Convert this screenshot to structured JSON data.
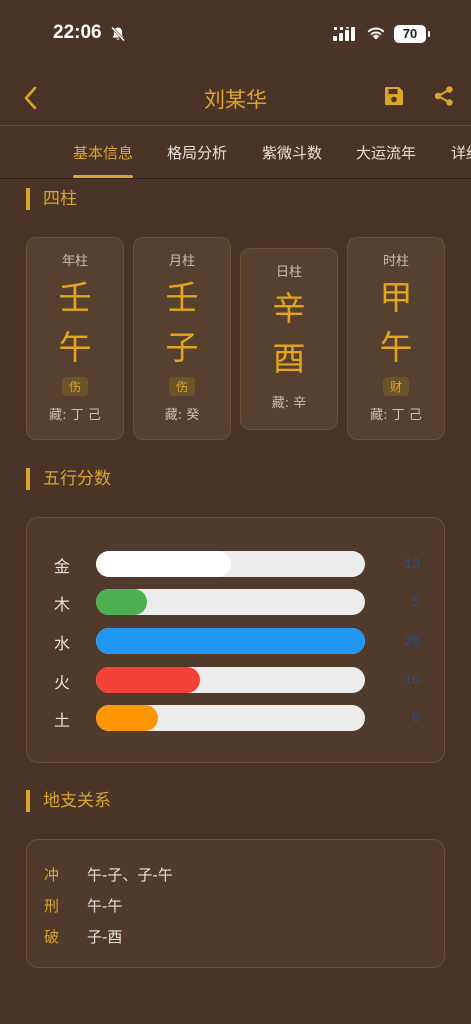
{
  "status": {
    "time": "22:06",
    "battery": "70"
  },
  "nav": {
    "title": "刘某华"
  },
  "tabs": [
    "基本信息",
    "格局分析",
    "紫微斗数",
    "大运流年",
    "详细"
  ],
  "sections": {
    "sizhu": "四柱",
    "wuxing": "五行分数",
    "dizhi": "地支关系"
  },
  "pillars": [
    {
      "label": "年柱",
      "gan": "壬",
      "zhi": "午",
      "shishen": "伤",
      "cang": "藏: 丁 己"
    },
    {
      "label": "月柱",
      "gan": "壬",
      "zhi": "子",
      "shishen": "伤",
      "cang": "藏: 癸"
    },
    {
      "label": "日柱",
      "gan": "辛",
      "zhi": "酉",
      "shishen": "",
      "cang": "藏: 辛"
    },
    {
      "label": "时柱",
      "gan": "甲",
      "zhi": "午",
      "shishen": "财",
      "cang": "藏: 丁 己"
    }
  ],
  "wuxing": [
    {
      "name": "金",
      "value": 13,
      "fraction": 0.5,
      "color": "#ffffff"
    },
    {
      "name": "木",
      "value": 5,
      "fraction": 0.19,
      "color": "#4caf50"
    },
    {
      "name": "水",
      "value": 26,
      "fraction": 1.0,
      "color": "#2196f3"
    },
    {
      "name": "火",
      "value": 10,
      "fraction": 0.385,
      "color": "#f44336"
    },
    {
      "name": "土",
      "value": 6,
      "fraction": 0.23,
      "color": "#ff9800"
    }
  ],
  "relations": [
    {
      "type": "冲",
      "value": "午-子、子-午"
    },
    {
      "type": "刑",
      "value": "午-午"
    },
    {
      "type": "破",
      "value": "子-酉"
    }
  ],
  "colors": {
    "accent": "#d9a52a",
    "background": "#4a3427",
    "value_text": "#2d4f88"
  }
}
